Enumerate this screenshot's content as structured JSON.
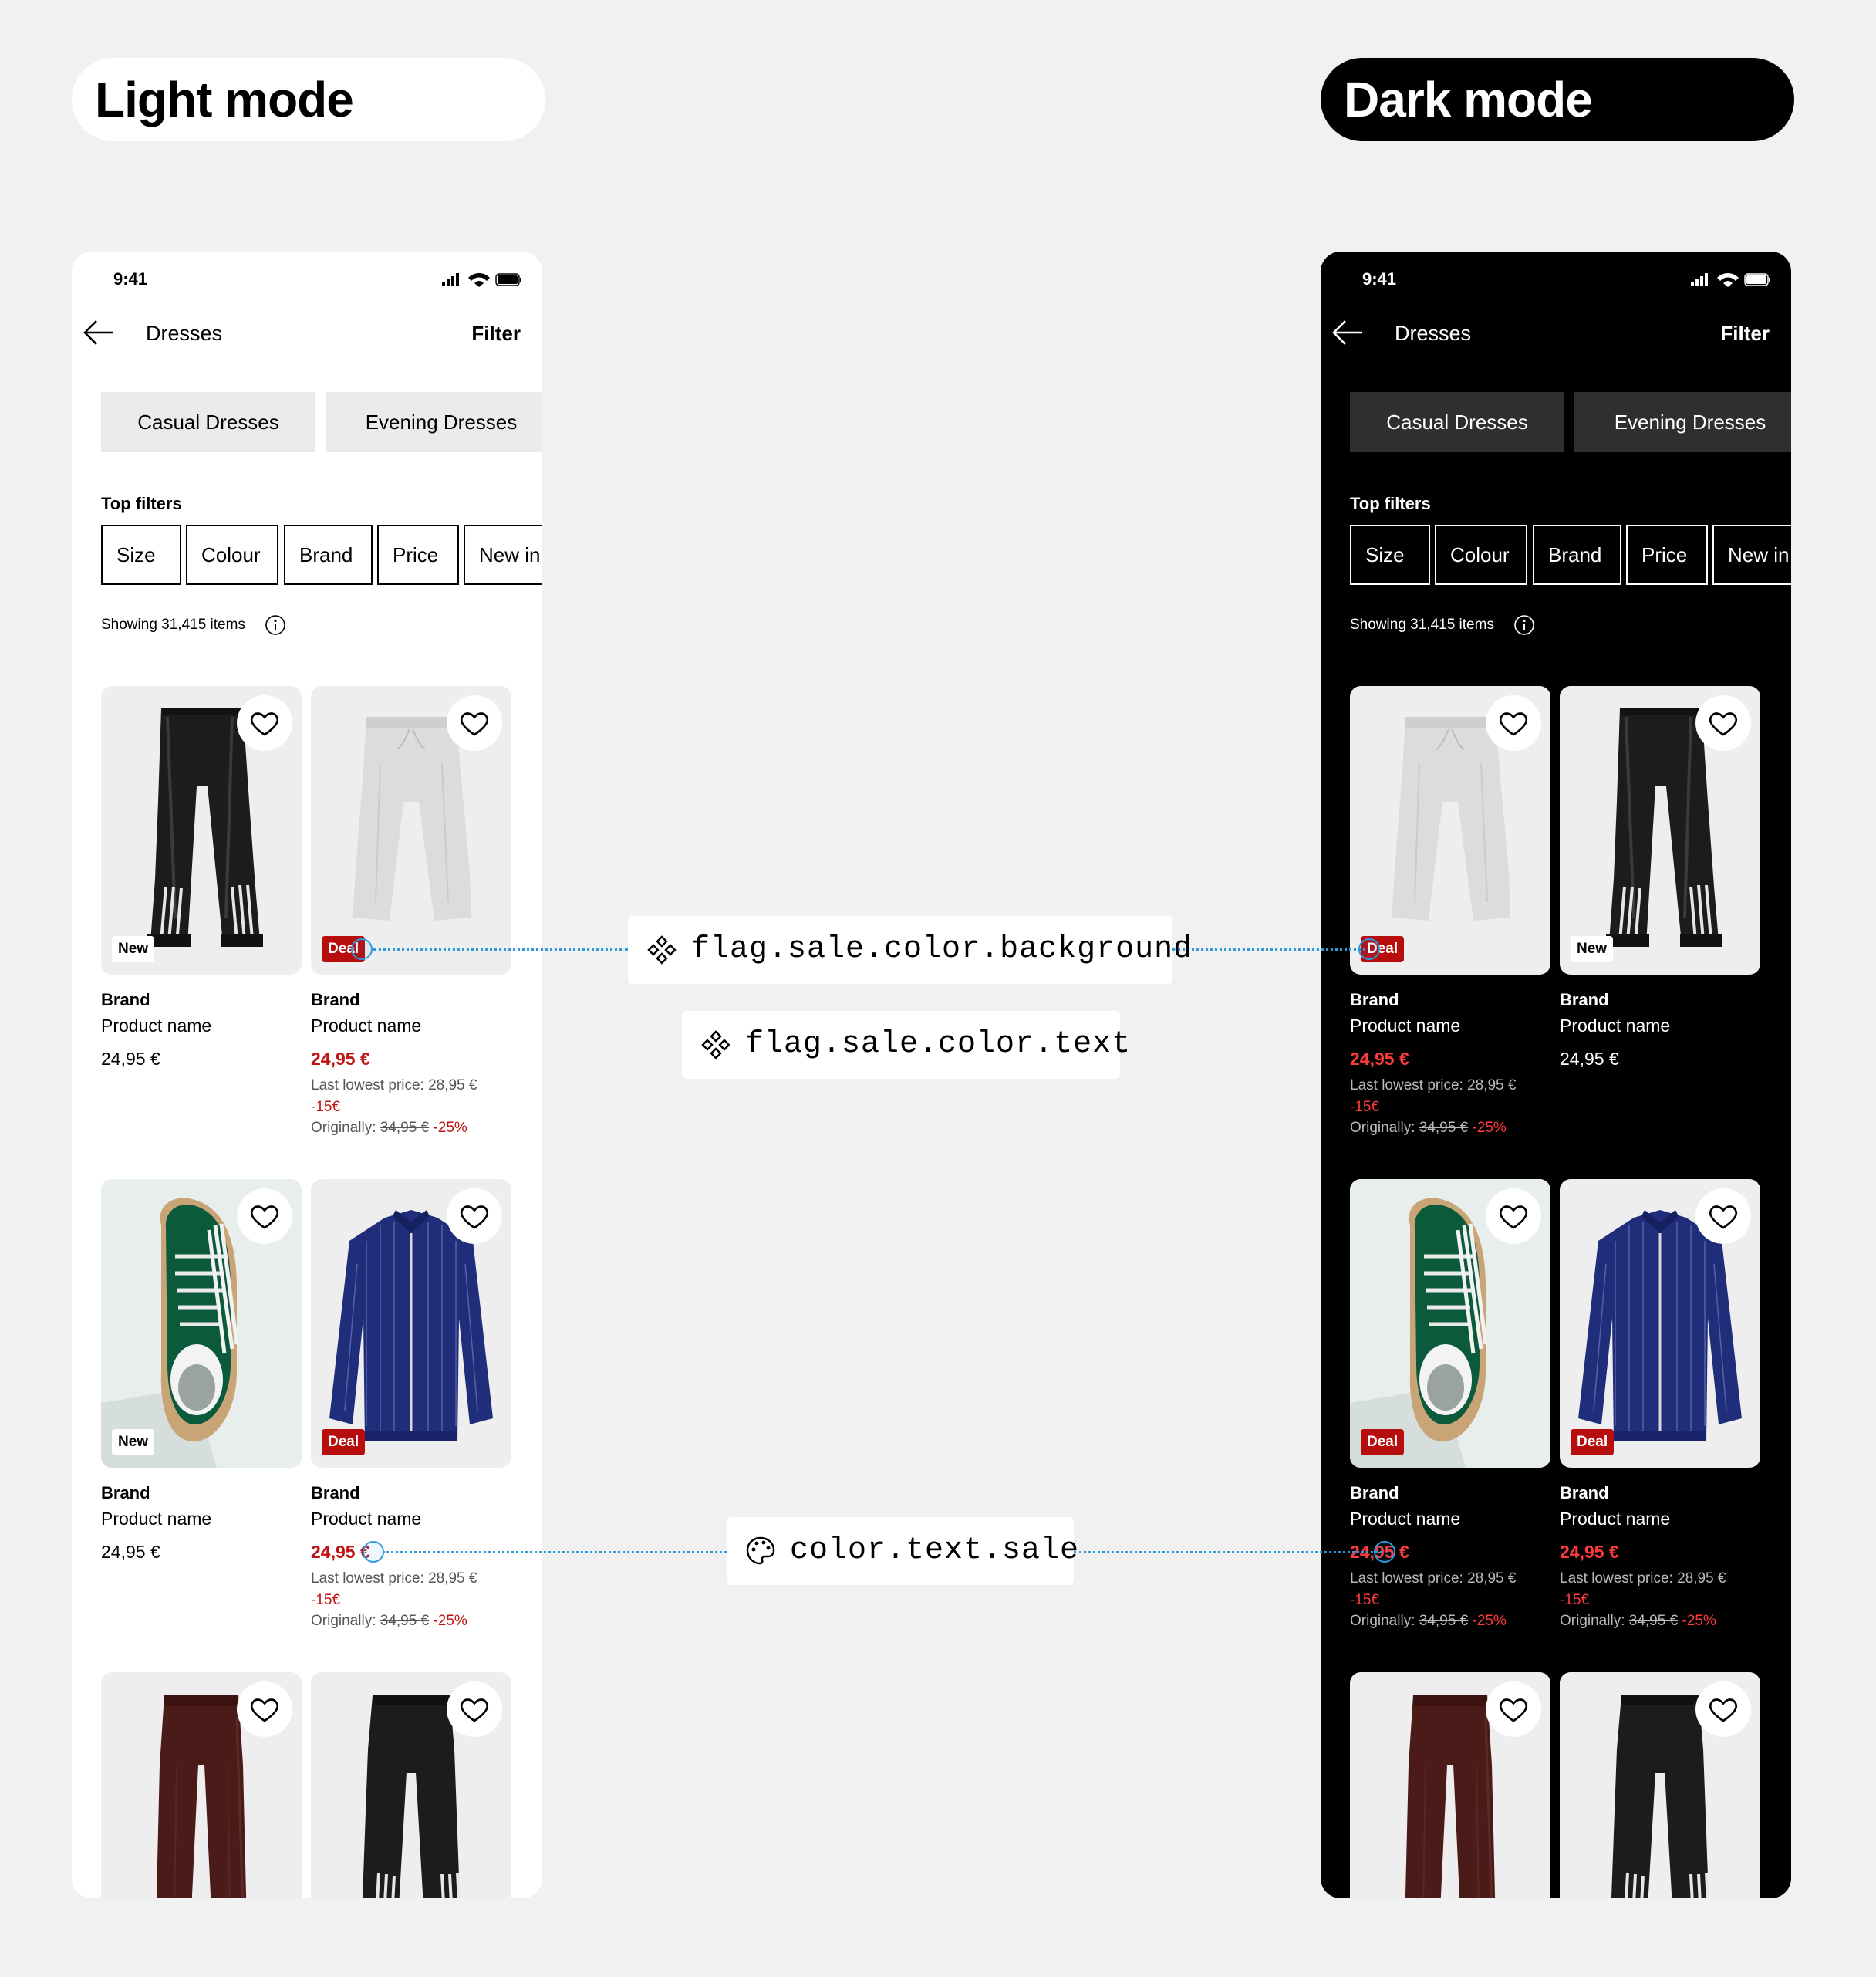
{
  "headers": {
    "light": "Light mode",
    "dark": "Dark mode"
  },
  "status": {
    "time": "9:41"
  },
  "nav": {
    "title": "Dresses",
    "filter": "Filter"
  },
  "categories": [
    "Casual Dresses",
    "Evening Dresses"
  ],
  "top_filters": {
    "label": "Top filters",
    "chips": [
      "Size",
      "Colour",
      "Brand",
      "Price",
      "New in"
    ]
  },
  "showing": "Showing 31,415 items",
  "product": {
    "brand": "Brand",
    "name": "Product name",
    "price": "24,95 €",
    "lowest": "Last lowest price: 28,95 €",
    "diff": "-15€",
    "orig_label": "Originally:",
    "orig_price": "34,95 €",
    "orig_pct": "-25%",
    "flag_new": "New",
    "flag_deal": "Deal"
  },
  "tokens": {
    "flag_bg": "flag.sale.color.background",
    "flag_text": "flag.sale.color.text",
    "text_sale": "color.text.sale"
  },
  "colors": {
    "sale": "#c01212",
    "sale_dark": "#ff3b3b",
    "annotation": "#2b9ae0",
    "deal_flag": "#b80d0d"
  }
}
